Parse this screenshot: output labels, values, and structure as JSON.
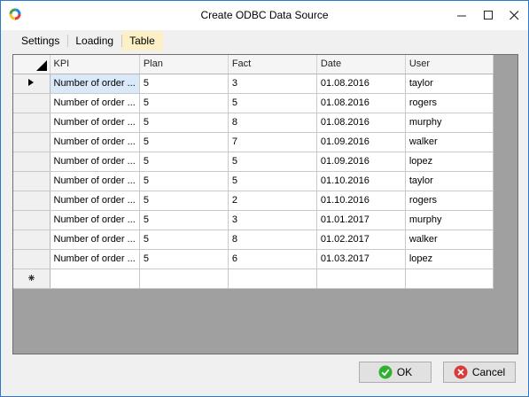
{
  "window": {
    "title": "Create ODBC Data Source",
    "app_icon": "colorful-ring-icon"
  },
  "tabs": [
    {
      "label": "Settings",
      "active": false
    },
    {
      "label": "Loading",
      "active": false
    },
    {
      "label": "Table",
      "active": true
    }
  ],
  "grid": {
    "columns": [
      "KPI",
      "Plan",
      "Fact",
      "Date",
      "User"
    ],
    "rows": [
      {
        "kpi": "Number of order ...",
        "plan": "5",
        "fact": "3",
        "date": "01.08.2016",
        "user": "taylor"
      },
      {
        "kpi": "Number of order ...",
        "plan": "5",
        "fact": "5",
        "date": "01.08.2016",
        "user": "rogers"
      },
      {
        "kpi": "Number of order ...",
        "plan": "5",
        "fact": "8",
        "date": "01.08.2016",
        "user": "murphy"
      },
      {
        "kpi": "Number of order ...",
        "plan": "5",
        "fact": "7",
        "date": "01.09.2016",
        "user": "walker"
      },
      {
        "kpi": "Number of order ...",
        "plan": "5",
        "fact": "5",
        "date": "01.09.2016",
        "user": "lopez"
      },
      {
        "kpi": "Number of order ...",
        "plan": "5",
        "fact": "5",
        "date": "01.10.2016",
        "user": "taylor"
      },
      {
        "kpi": "Number of order ...",
        "plan": "5",
        "fact": "2",
        "date": "01.10.2016",
        "user": "rogers"
      },
      {
        "kpi": "Number of order ...",
        "plan": "5",
        "fact": "3",
        "date": "01.01.2017",
        "user": "murphy"
      },
      {
        "kpi": "Number of order ...",
        "plan": "5",
        "fact": "8",
        "date": "01.02.2017",
        "user": "walker"
      },
      {
        "kpi": "Number of order ...",
        "plan": "5",
        "fact": "6",
        "date": "01.03.2017",
        "user": "lopez"
      }
    ],
    "current_row_marker": "current-row-arrow-icon",
    "new_row_marker": "new-row-asterisk-icon"
  },
  "buttons": {
    "ok": {
      "label": "OK",
      "icon": "green-check-icon"
    },
    "cancel": {
      "label": "Cancel",
      "icon": "red-x-icon"
    }
  },
  "colors": {
    "active_tab": "#fdefc6",
    "grid_background": "#a0a0a0",
    "selected_cell": "#d9e9f9",
    "ok_green": "#2fb12f",
    "cancel_red": "#d93a3a"
  }
}
